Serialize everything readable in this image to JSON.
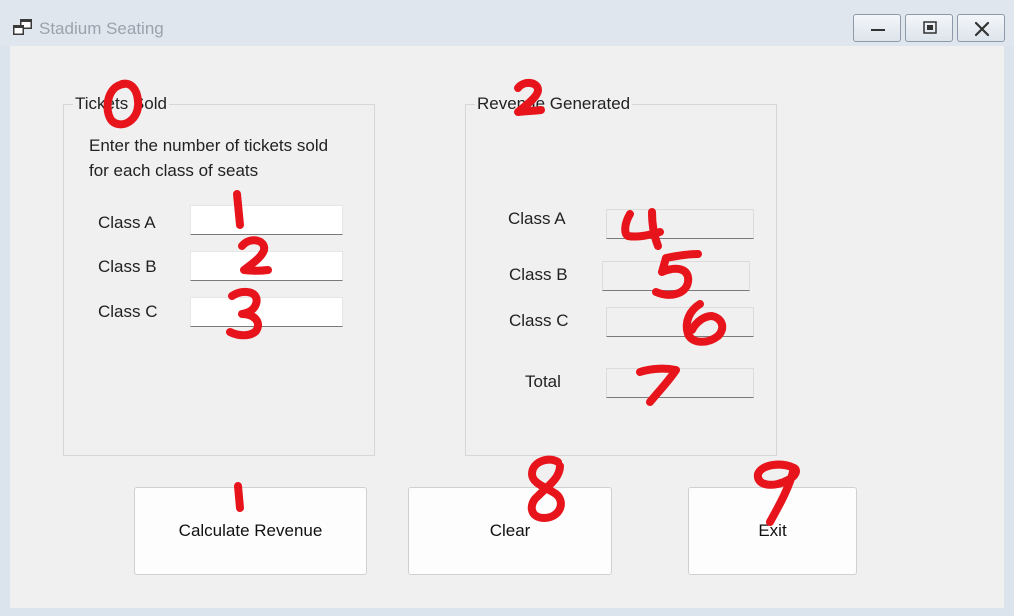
{
  "window": {
    "title": "Stadium Seating",
    "icon": "app-window-icon"
  },
  "title_controls": {
    "minimize": "minimize-icon",
    "restore": "restore-icon",
    "close": "close-icon"
  },
  "tickets_group": {
    "label": "Tickets Sold",
    "instruction_line1": "Enter  the number of tickets sold",
    "instruction_line2": "for each class of seats",
    "class_a_label": "Class A",
    "class_b_label": "Class B",
    "class_c_label": "Class C",
    "class_a_value": "",
    "class_b_value": "",
    "class_c_value": ""
  },
  "revenue_group": {
    "label": "Revenue Generated",
    "class_a_label": "Class A",
    "class_b_label": "Class B",
    "class_c_label": "Class C",
    "total_label": "Total",
    "class_a_value": "",
    "class_b_value": "",
    "class_c_value": "",
    "total_value": ""
  },
  "buttons": {
    "calculate": "Calculate Revenue",
    "clear": "Clear",
    "exit": "Exit"
  },
  "annotations": {
    "color": "#e8141c",
    "marks": [
      "0",
      "1",
      "2",
      "3",
      "2",
      "4",
      "5",
      "6",
      "7",
      "1",
      "8",
      "9"
    ]
  }
}
